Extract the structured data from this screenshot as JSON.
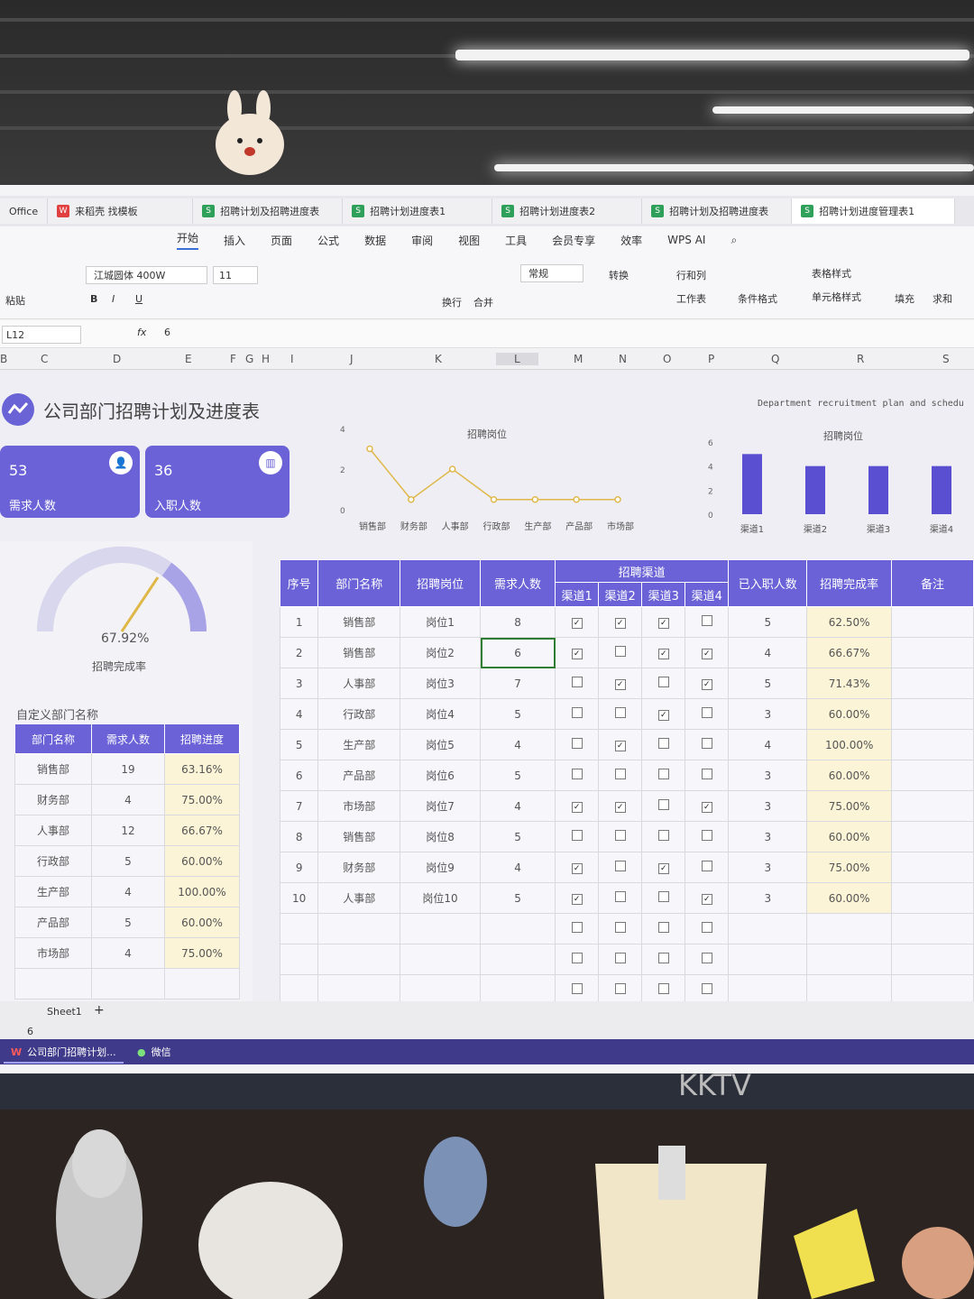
{
  "browser_tabs": [
    {
      "label": "Office",
      "icon": "office-icon"
    },
    {
      "label": "来稻壳 找模板",
      "icon": "docer-icon"
    },
    {
      "label": "招聘计划及招聘进度表",
      "icon": "sheet-icon"
    },
    {
      "label": "招聘计划进度表1",
      "icon": "sheet-icon"
    },
    {
      "label": "招聘计划进度表2",
      "icon": "sheet-icon"
    },
    {
      "label": "招聘计划及招聘进度表",
      "icon": "sheet-icon"
    },
    {
      "label": "招聘计划进度管理表1",
      "icon": "sheet-icon"
    }
  ],
  "menu": [
    "开始",
    "插入",
    "页面",
    "公式",
    "数据",
    "审阅",
    "视图",
    "工具",
    "会员专享",
    "效率",
    "WPS AI"
  ],
  "ribbon": {
    "paste": "粘贴",
    "font": "江城圆体 400W",
    "size": "11",
    "wrap": "换行",
    "merge": "合并",
    "number_format": "常规",
    "convert": "转换",
    "rowcol": "行和列",
    "worksheet": "工作表",
    "cond_format": "条件格式",
    "table_style": "表格样式",
    "cell_style": "单元格样式",
    "fill": "填充",
    "sum": "求和"
  },
  "formula": {
    "cell": "L12",
    "fx": "fx",
    "value": "6"
  },
  "columns": [
    "B",
    "C",
    "D",
    "E",
    "F",
    "G",
    "H",
    "I",
    "J",
    "K",
    "L",
    "M",
    "N",
    "O",
    "P",
    "Q",
    "R",
    "S"
  ],
  "sheet": {
    "title": "公司部门招聘计划及进度表",
    "subtitle": "Department recruitment plan and schedu",
    "card1": {
      "value": "53",
      "label": "需求人数"
    },
    "card2": {
      "value": "36",
      "label": "入职人数"
    },
    "gauge_value": "67.92%",
    "gauge_label": "招聘完成率",
    "custom_label": "自定义部门名称",
    "small_table": {
      "headers": [
        "部门名称",
        "需求人数",
        "招聘进度"
      ],
      "rows": [
        [
          "销售部",
          "19",
          "63.16%"
        ],
        [
          "财务部",
          "4",
          "75.00%"
        ],
        [
          "人事部",
          "12",
          "66.67%"
        ],
        [
          "行政部",
          "5",
          "60.00%"
        ],
        [
          "生产部",
          "4",
          "100.00%"
        ],
        [
          "产品部",
          "5",
          "60.00%"
        ],
        [
          "市场部",
          "4",
          "75.00%"
        ]
      ]
    },
    "main_table": {
      "headers": {
        "seq": "序号",
        "dept": "部门名称",
        "post": "招聘岗位",
        "need": "需求人数",
        "channel": "招聘渠道",
        "c1": "渠道1",
        "c2": "渠道2",
        "c3": "渠道3",
        "c4": "渠道4",
        "hired": "已入职人数",
        "rate": "招聘完成率",
        "note": "备注"
      },
      "rows": [
        {
          "seq": "1",
          "dept": "销售部",
          "post": "岗位1",
          "need": "8",
          "c": [
            1,
            1,
            1,
            0
          ],
          "hired": "5",
          "rate": "62.50%"
        },
        {
          "seq": "2",
          "dept": "销售部",
          "post": "岗位2",
          "need": "6",
          "c": [
            1,
            0,
            1,
            1
          ],
          "hired": "4",
          "rate": "66.67%"
        },
        {
          "seq": "3",
          "dept": "人事部",
          "post": "岗位3",
          "need": "7",
          "c": [
            0,
            1,
            0,
            1
          ],
          "hired": "5",
          "rate": "71.43%"
        },
        {
          "seq": "4",
          "dept": "行政部",
          "post": "岗位4",
          "need": "5",
          "c": [
            0,
            0,
            1,
            0
          ],
          "hired": "3",
          "rate": "60.00%"
        },
        {
          "seq": "5",
          "dept": "生产部",
          "post": "岗位5",
          "need": "4",
          "c": [
            0,
            1,
            0,
            0
          ],
          "hired": "4",
          "rate": "100.00%"
        },
        {
          "seq": "6",
          "dept": "产品部",
          "post": "岗位6",
          "need": "5",
          "c": [
            0,
            0,
            0,
            0
          ],
          "hired": "3",
          "rate": "60.00%"
        },
        {
          "seq": "7",
          "dept": "市场部",
          "post": "岗位7",
          "need": "4",
          "c": [
            1,
            1,
            0,
            1
          ],
          "hired": "3",
          "rate": "75.00%"
        },
        {
          "seq": "8",
          "dept": "销售部",
          "post": "岗位8",
          "need": "5",
          "c": [
            0,
            0,
            0,
            0
          ],
          "hired": "3",
          "rate": "60.00%"
        },
        {
          "seq": "9",
          "dept": "财务部",
          "post": "岗位9",
          "need": "4",
          "c": [
            1,
            0,
            1,
            0
          ],
          "hired": "3",
          "rate": "75.00%"
        },
        {
          "seq": "10",
          "dept": "人事部",
          "post": "岗位10",
          "need": "5",
          "c": [
            1,
            0,
            0,
            1
          ],
          "hired": "3",
          "rate": "60.00%"
        }
      ]
    },
    "sheet_tab": "Sheet1",
    "status_value": "6"
  },
  "taskbar": {
    "app1": "公司部门招聘计划...",
    "app2": "微信"
  },
  "brand": "KKTV",
  "chart_data": [
    {
      "type": "line",
      "title": "招聘岗位",
      "categories": [
        "销售部",
        "财务部",
        "人事部",
        "行政部",
        "生产部",
        "产品部",
        "市场部"
      ],
      "values": [
        3,
        0.5,
        2,
        0.5,
        0.5,
        0.5,
        0.5
      ],
      "ylim": [
        0,
        4
      ],
      "yticks": [
        0,
        2,
        4
      ],
      "color": "#e0b84a"
    },
    {
      "type": "bar",
      "title": "招聘岗位",
      "categories": [
        "渠道1",
        "渠道2",
        "渠道3",
        "渠道4"
      ],
      "values": [
        5,
        4,
        4,
        4
      ],
      "ylim": [
        0,
        6
      ],
      "yticks": [
        0,
        2,
        4,
        6
      ],
      "color": "#5a4fd0"
    }
  ]
}
